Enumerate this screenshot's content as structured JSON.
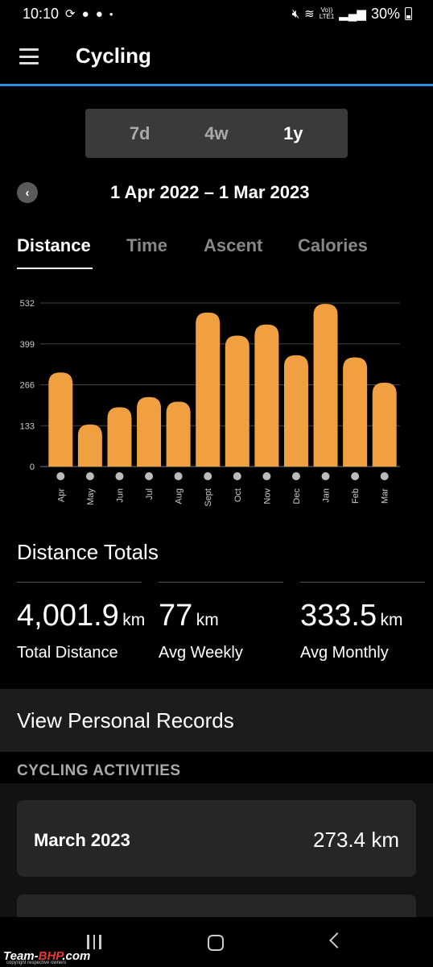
{
  "status_bar": {
    "time": "10:10",
    "battery": "30%",
    "network": "LTE1",
    "volte": "Vo))"
  },
  "app_bar": {
    "title": "Cycling"
  },
  "period_selector": {
    "options": [
      "7d",
      "4w",
      "1y"
    ],
    "selected": "1y"
  },
  "date_range": {
    "text": "1 Apr 2022 – 1 Mar 2023"
  },
  "metric_tabs": {
    "items": [
      "Distance",
      "Time",
      "Ascent",
      "Calories"
    ],
    "selected": "Distance"
  },
  "chart_data": {
    "type": "bar",
    "categories": [
      "Apr",
      "May",
      "Jun",
      "Jul",
      "Aug",
      "Sept",
      "Oct",
      "Nov",
      "Dec",
      "Jan",
      "Feb",
      "Mar"
    ],
    "values": [
      306,
      137,
      193,
      226,
      211,
      501,
      426,
      462,
      362,
      529,
      355,
      273
    ],
    "yticks": [
      0,
      133,
      266,
      399,
      532
    ],
    "ylim": [
      0,
      532
    ],
    "bar_color": "#f0a040",
    "grid": true
  },
  "totals": {
    "title": "Distance Totals",
    "items": [
      {
        "value": "4,001.9",
        "unit": "km",
        "label": "Total Distance"
      },
      {
        "value": "77",
        "unit": "km",
        "label": "Avg Weekly"
      },
      {
        "value": "333.5",
        "unit": "km",
        "label": "Avg Monthly"
      }
    ]
  },
  "records_link": "View Personal Records",
  "activities": {
    "header": "CYCLING ACTIVITIES",
    "items": [
      {
        "month": "March 2023",
        "distance": "273.4 km"
      }
    ]
  },
  "watermark": {
    "brand_a": "Team-",
    "brand_b": "BHP",
    "brand_c": ".com",
    "sub": "copyright respective owners"
  },
  "colors": {
    "accent_line": "#2a8fd8",
    "bar": "#f0a040",
    "background": "#000000"
  }
}
